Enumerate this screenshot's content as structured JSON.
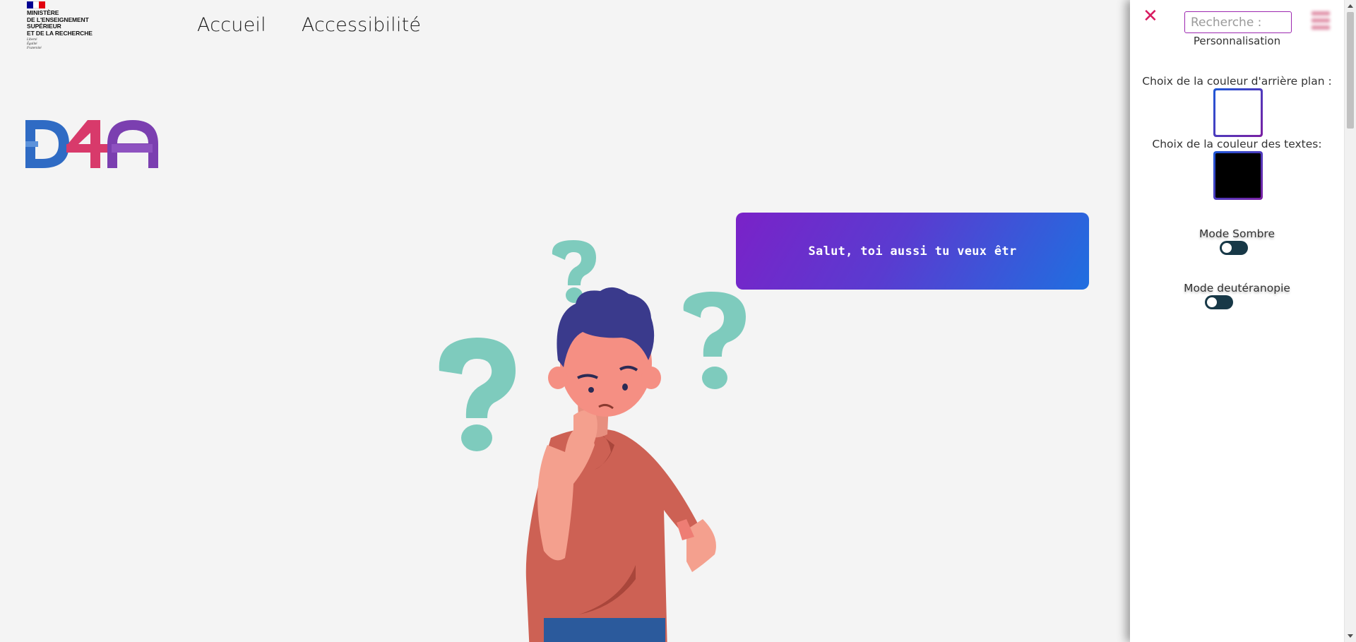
{
  "ministry": {
    "name": "MINISTÈRE\nDE L'ENSEIGNEMENT\nSUPÉRIEUR\nET DE LA RECHERCHE",
    "motto": "Liberté\nÉgalité\nFraternité"
  },
  "nav": {
    "items": [
      {
        "label": "Accueil"
      },
      {
        "label": "Accessibilité"
      }
    ]
  },
  "brand": {
    "letters": [
      "D",
      "4",
      "A"
    ],
    "colors": {
      "d": "#2f6bc4",
      "four": "#d83a6b",
      "a": "#7b3fb0"
    }
  },
  "bubble": {
    "text": "Salut, toi aussi tu veux êtr"
  },
  "illustration": {
    "icon": "thinking-person-illustration",
    "question_mark_color": "#7ecbbd"
  },
  "panel": {
    "close_icon": "close-icon",
    "search_placeholder": "Recherche :",
    "subtitle": "Personnalisation",
    "bg_color_label": "Choix de la couleur d'arrière plan :",
    "bg_color_value": "#ffffff",
    "text_color_label": "Choix de la couleur des textes:",
    "text_color_value": "#000000",
    "dark_mode_label": "Mode Sombre",
    "dark_mode_on": false,
    "deuteranopia_label": "Mode deutéranopie",
    "deuteranopia_on": false,
    "accent": "#d81b60"
  }
}
